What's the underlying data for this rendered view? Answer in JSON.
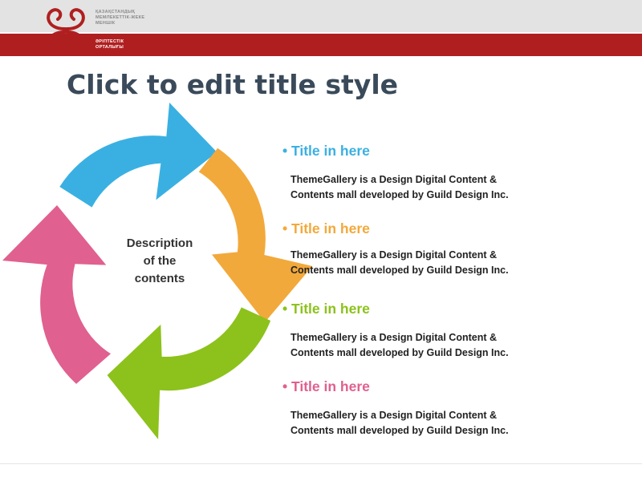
{
  "header": {
    "org_top": [
      "ҚАЗАҚСТАНДЫҚ",
      "МЕМЛЕКЕТТІК-ЖЕКЕ",
      "МЕНШІК"
    ],
    "org_bottom": [
      "ӘРІПТЕСТІК",
      "ОРТАЛЫҒЫ"
    ],
    "logo_icon": "ornament-logo-icon"
  },
  "slide": {
    "title": "Click to edit title style",
    "center": [
      "Description",
      "of the",
      "contents"
    ]
  },
  "items": [
    {
      "title": "• Title in here",
      "desc": [
        "ThemeGallery is a Design Digital Content &",
        "Contents mall developed by Guild Design Inc."
      ],
      "color": "#3ab0e2"
    },
    {
      "title": "• Title in here",
      "desc": [
        "ThemeGallery is a Design Digital Content &",
        "Contents mall developed by Guild Design Inc."
      ],
      "color": "#f2a93b"
    },
    {
      "title": "• Title in here",
      "desc": [
        "ThemeGallery is a Design Digital Content &",
        "Contents mall developed by Guild Design Inc."
      ],
      "color": "#8cc21b"
    },
    {
      "title": "• Title in here",
      "desc": [
        "ThemeGallery is a Design Digital Content &",
        "Contents mall developed by Guild Design Inc."
      ],
      "color": "#e0608f"
    }
  ],
  "colors": {
    "header_red": "#b01f20",
    "header_grey": "#e3e3e3",
    "title": "#3a4a5a"
  }
}
